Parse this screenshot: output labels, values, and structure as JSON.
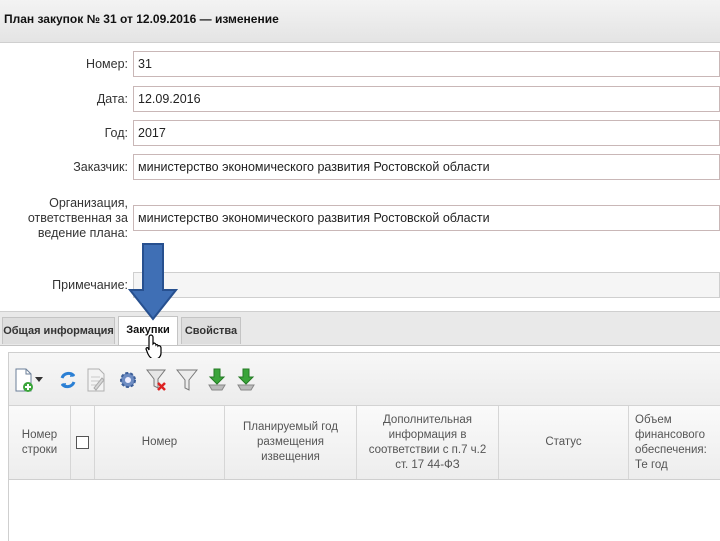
{
  "window": {
    "title": "План закупок № 31 от 12.09.2016 — изменение"
  },
  "form": {
    "number": {
      "label": "Номер:",
      "value": "31"
    },
    "date": {
      "label": "Дата:",
      "value": "12.09.2016"
    },
    "year": {
      "label": "Год:",
      "value": "2017"
    },
    "customer": {
      "label": "Заказчик:",
      "value": "министерство экономического развития Ростовской области"
    },
    "organization": {
      "label": "Организация, ответственная за ведение плана:",
      "value": "министерство экономического развития Ростовской области"
    },
    "note": {
      "label": "Примечание:",
      "value": ""
    }
  },
  "tabs": [
    {
      "label": "Общая информация"
    },
    {
      "label": "Закупки"
    },
    {
      "label": "Свойства"
    }
  ],
  "active_tab": "Закупки",
  "toolbar": {
    "icons": [
      "add-document-icon",
      "dropdown-arrow-icon",
      "refresh-icon",
      "edit-document-icon",
      "settings-gear-icon",
      "clear-filter-icon",
      "filter-icon",
      "import-green-icon",
      "export-green-icon"
    ]
  },
  "grid": {
    "columns": [
      "Номер строки",
      "",
      "Номер",
      "Планируемый год размещения извещения",
      "Дополнительная информация в соответствии с п.7 ч.2 ст. 17 44-ФЗ",
      "Статус",
      "Объем финансового обеспечения: Те год"
    ],
    "rows": []
  },
  "colors": {
    "arrow": "#3f6fb5",
    "tab_active": "#ffffff",
    "field_border": "#c9b7b7"
  }
}
